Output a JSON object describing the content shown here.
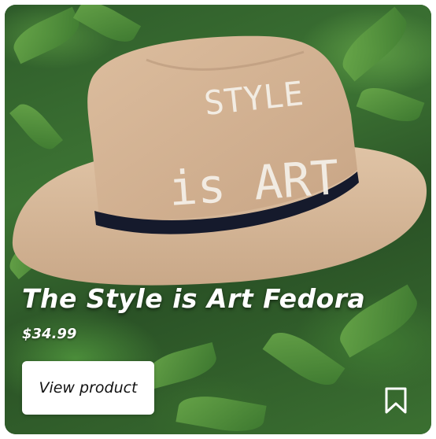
{
  "product": {
    "title": "The Style is Art Fedora",
    "price": "$34.99",
    "hat_text_line1": "STYLE",
    "hat_text_line2": "is ART",
    "image_colors": {
      "hat": "#d4b597",
      "band": "#151a2c",
      "foliage": "#3c7333"
    }
  },
  "actions": {
    "view_label": "View product",
    "bookmark_icon": "bookmark-icon"
  }
}
